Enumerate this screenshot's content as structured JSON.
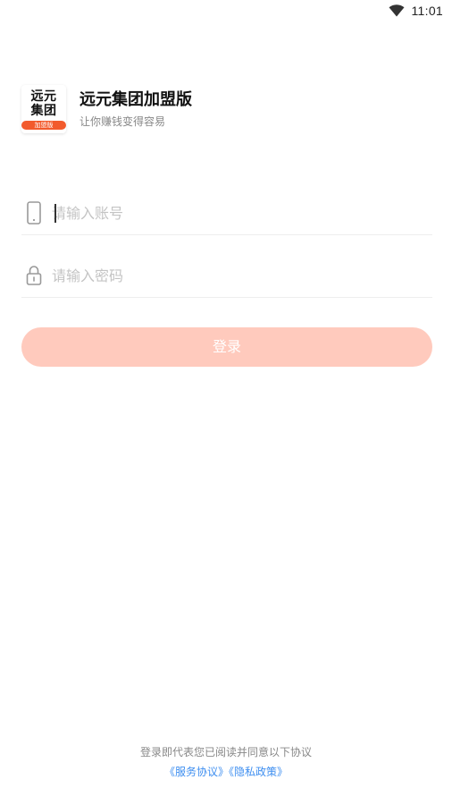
{
  "status_bar": {
    "time": "11:01",
    "wifi_icon": "wifi-icon"
  },
  "app": {
    "logo_text": "远元\n集团",
    "logo_badge": "加盟版",
    "title": "远元集团加盟版",
    "subtitle": "让你赚钱变得容易"
  },
  "form": {
    "account_placeholder": "请输入账号",
    "account_value": "",
    "account_icon": "phone-icon",
    "password_placeholder": "请输入密码",
    "password_value": "",
    "password_icon": "lock-icon"
  },
  "login": {
    "label": "登录",
    "color": "#ffcabd"
  },
  "footer": {
    "agreement_text": "登录即代表您已阅读并同意以下协议",
    "service_link": "《服务协议》",
    "privacy_link": "《隐私政策》",
    "link_color": "#3d8ef0"
  },
  "colors": {
    "brand": "#f25a2c",
    "placeholder": "#c4c4c4"
  }
}
